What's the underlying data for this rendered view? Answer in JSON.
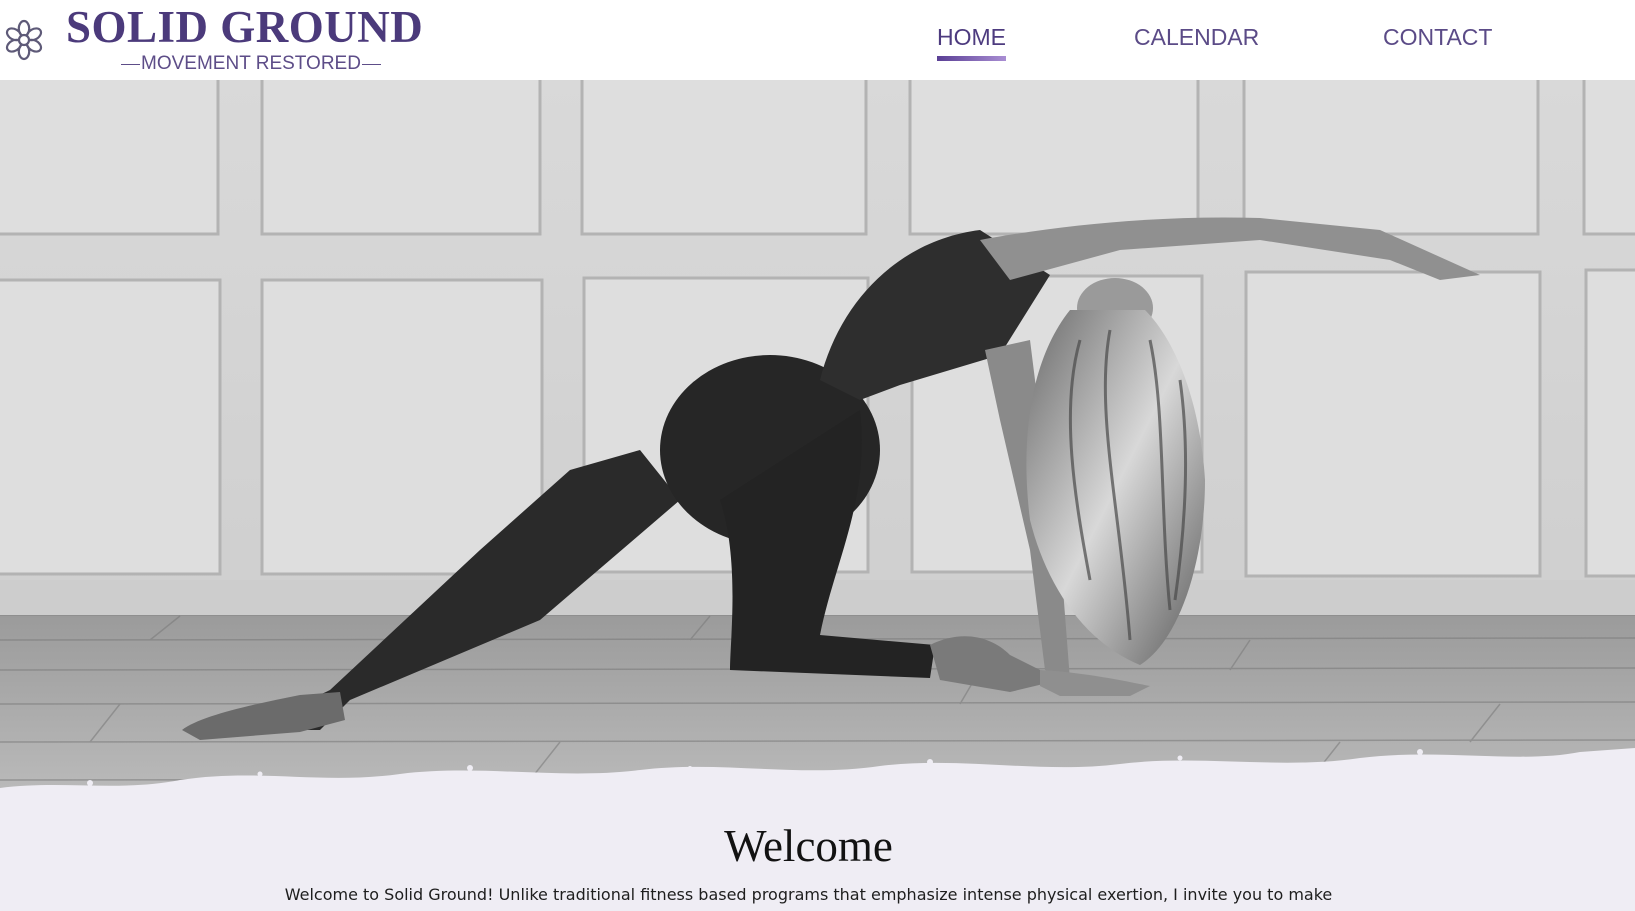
{
  "brand": {
    "title": "SOLID GROUND",
    "tagline": "MOVEMENT RESTORED",
    "logo_icon": "flower-icon",
    "color": "#4b3a7b"
  },
  "nav": {
    "items": [
      {
        "label": "HOME",
        "active": true
      },
      {
        "label": "CALENDAR",
        "active": false
      },
      {
        "label": "CONTACT",
        "active": false
      }
    ],
    "accent_color": "#5a3f95"
  },
  "hero": {
    "image": "black-and-white-photo-woman-yoga-pose-wooden-floor"
  },
  "welcome": {
    "heading": "Welcome",
    "text": "Welcome to Solid Ground! Unlike traditional fitness based programs that emphasize intense physical exertion, I invite you to make",
    "background": "#efedf4"
  }
}
